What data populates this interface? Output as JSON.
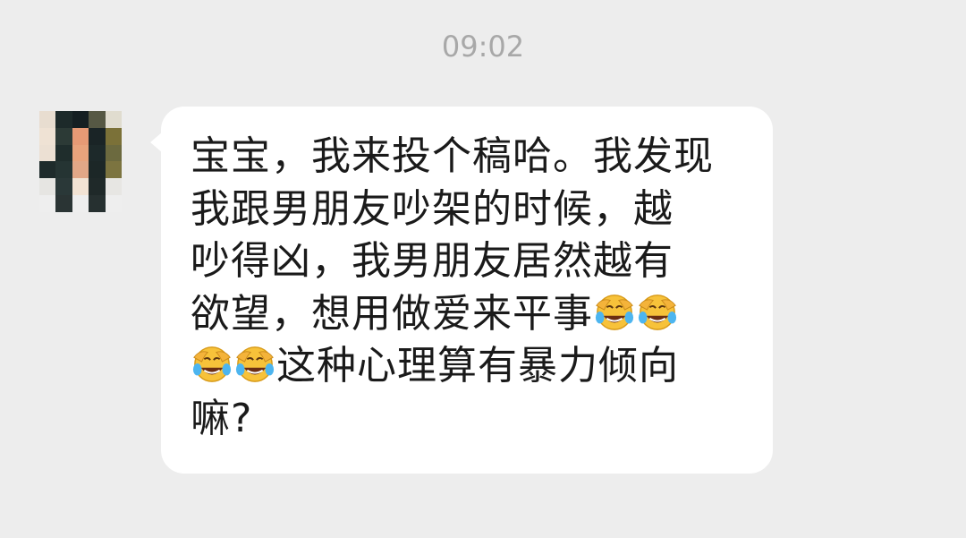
{
  "timestamp": "09:02",
  "message": {
    "avatar_icon": "pixelated-avatar-icon",
    "emoji_icon": "face-with-tears-of-joy-covering-face-emoji",
    "lines": [
      {
        "segments": [
          {
            "type": "text",
            "text": "宝宝，我来投个稿哈。我发现"
          }
        ]
      },
      {
        "segments": [
          {
            "type": "text",
            "text": "我跟男朋友吵架的时候，越"
          }
        ]
      },
      {
        "segments": [
          {
            "type": "text",
            "text": "吵得凶，我男朋友居然越有"
          }
        ]
      },
      {
        "segments": [
          {
            "type": "text",
            "text": "欲望，想用做爱来平事"
          },
          {
            "type": "emoji"
          },
          {
            "type": "emoji"
          }
        ]
      },
      {
        "segments": [
          {
            "type": "emoji"
          },
          {
            "type": "emoji"
          },
          {
            "type": "text",
            "text": "这种心理算有暴力倾向"
          }
        ]
      },
      {
        "segments": [
          {
            "type": "text",
            "text": "嘛?"
          }
        ]
      }
    ]
  },
  "colors": {
    "background": "#ededed",
    "bubble": "#ffffff",
    "timestamp_text": "#a8a8a8",
    "message_text": "#1a1a1a",
    "avatar_pixels": [
      "#e8ddd0",
      "#1d2a2a",
      "#151f22",
      "#565844",
      "#e0dccf",
      "#efe2d4",
      "#2c3a36",
      "#e79a75",
      "#1a2426",
      "#7b7138",
      "#ece0d3",
      "#1f2d2c",
      "#e9a37c",
      "#1d292a",
      "#6c6a3f",
      "#1e2b2b",
      "#253433",
      "#e2a787",
      "#1c2727",
      "#7c7440",
      "#e6e5e2",
      "#2a3838",
      "#f2e3d4",
      "#1f2929",
      "#e7e6e3",
      "#eeeeee",
      "#2a3434",
      "#eeeeee",
      "#263030",
      "#eeeeee"
    ]
  }
}
